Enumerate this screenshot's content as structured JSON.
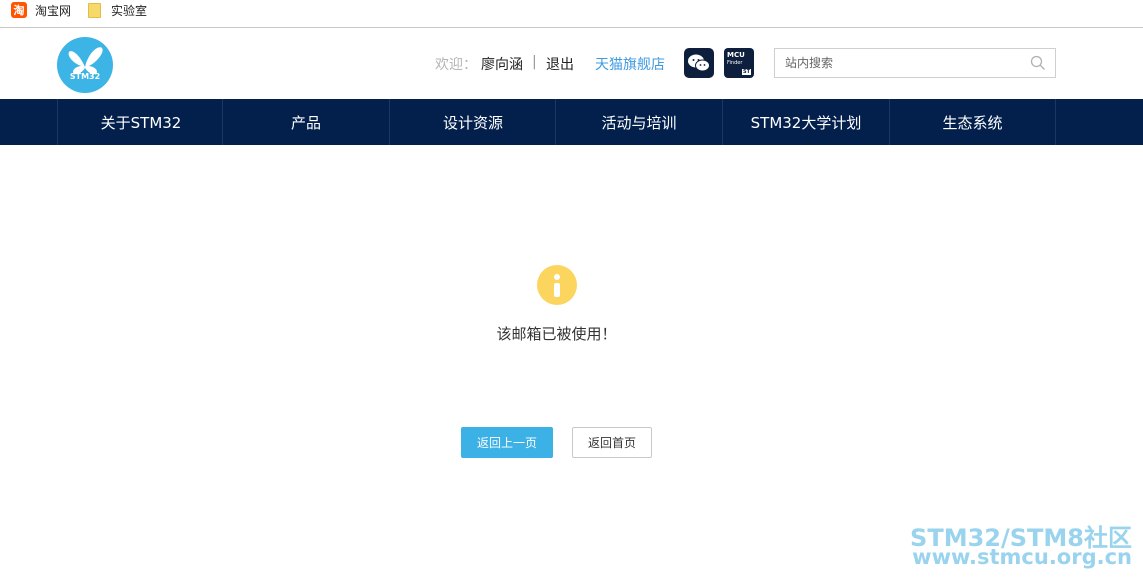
{
  "bookmarks": [
    {
      "label": "淘宝网",
      "icon": "taobao-icon",
      "glyph": "淘"
    },
    {
      "label": "实验室",
      "icon": "folder-icon"
    }
  ],
  "header": {
    "logo_text": "STM32",
    "welcome": "欢迎：",
    "username": "廖向涵",
    "separator": "|",
    "logout": "退出",
    "tmall": "天猫旗舰店",
    "mcu_finder": {
      "line1": "MCU",
      "line2": "Finder",
      "badge": "ST"
    },
    "search": {
      "placeholder": "站内搜索",
      "value": ""
    }
  },
  "nav": {
    "items": [
      "关于STM32",
      "产品",
      "设计资源",
      "活动与培训",
      "STM32大学计划",
      "生态系统"
    ]
  },
  "content": {
    "message": "该邮箱已被使用！",
    "back_button": "返回上一页",
    "home_button": "返回首页"
  },
  "watermark": {
    "line1": "STM32/STM8社区",
    "line2": "www.stmcu.org.cn"
  },
  "colors": {
    "nav_bg": "#03204d",
    "accent": "#3cb1e6",
    "logo": "#3cb4e5",
    "info": "#fcd55e",
    "tmall_link": "#3f9be0"
  }
}
